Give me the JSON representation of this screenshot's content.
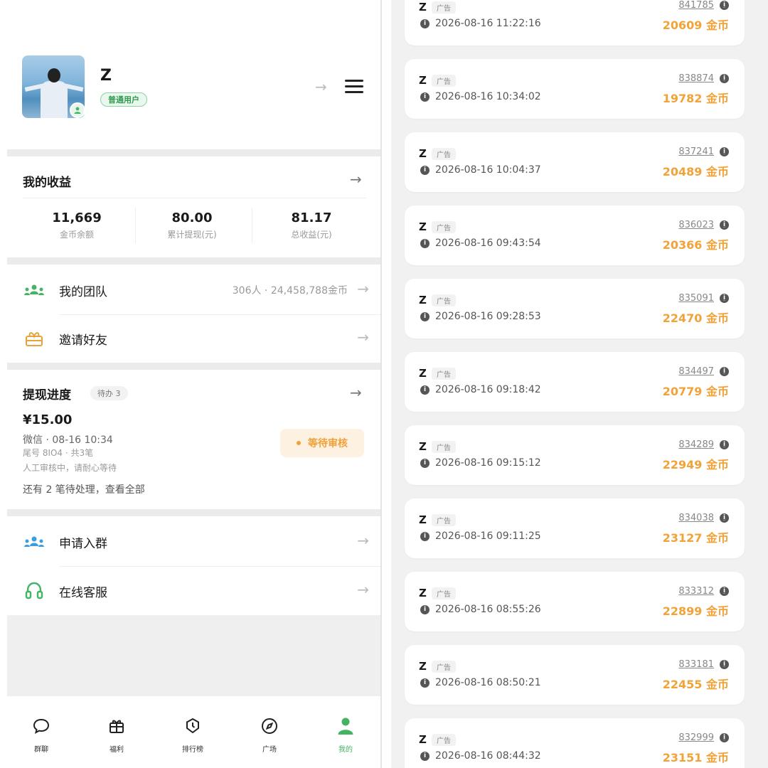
{
  "profile": {
    "name": "Z",
    "badge": "普通用户",
    "arrow": "→"
  },
  "earnings": {
    "title": "我的收益",
    "stats": [
      {
        "value": "11,669",
        "label": "金币余额"
      },
      {
        "value": "80.00",
        "label": "累计提现(元)"
      },
      {
        "value": "81.17",
        "label": "总收益(元)"
      }
    ]
  },
  "team": {
    "label": "我的团队",
    "meta": "306人 · 24,458,788金币"
  },
  "invite": {
    "label": "邀请好友"
  },
  "withdraw": {
    "title": "提现进度",
    "badge": "待办 3",
    "amount": "¥15.00",
    "line1": "微信 · 08-16 10:34",
    "line2": "尾号 8IO4 · 共3笔",
    "line3": "人工审核中，请耐心等待",
    "line4": "还有 2 笔待处理，查看全部",
    "status": "等待审核"
  },
  "join_group": {
    "label": "申请入群"
  },
  "support": {
    "label": "在线客服"
  },
  "tabs": [
    {
      "label": "群聊",
      "icon": "chat-bubble-icon"
    },
    {
      "label": "福利",
      "icon": "gift-icon"
    },
    {
      "label": "排行榜",
      "icon": "ranking-badge-icon"
    },
    {
      "label": "广场",
      "icon": "compass-icon"
    },
    {
      "label": "我的",
      "icon": "user-icon",
      "active": true
    }
  ],
  "records": [
    {
      "name": "Z",
      "tag": "广告",
      "time": "2026-08-16 11:22:16",
      "id": "841785",
      "coins": "20609 金币"
    },
    {
      "name": "Z",
      "tag": "广告",
      "time": "2026-08-16 10:34:02",
      "id": "838874",
      "coins": "19782 金币"
    },
    {
      "name": "Z",
      "tag": "广告",
      "time": "2026-08-16 10:04:37",
      "id": "837241",
      "coins": "20489 金币"
    },
    {
      "name": "Z",
      "tag": "广告",
      "time": "2026-08-16 09:43:54",
      "id": "836023",
      "coins": "20366 金币"
    },
    {
      "name": "Z",
      "tag": "广告",
      "time": "2026-08-16 09:28:53",
      "id": "835091",
      "coins": "22470 金币"
    },
    {
      "name": "Z",
      "tag": "广告",
      "time": "2026-08-16 09:18:42",
      "id": "834497",
      "coins": "20779 金币"
    },
    {
      "name": "Z",
      "tag": "广告",
      "time": "2026-08-16 09:15:12",
      "id": "834289",
      "coins": "22949 金币"
    },
    {
      "name": "Z",
      "tag": "广告",
      "time": "2026-08-16 09:11:25",
      "id": "834038",
      "coins": "23127 金币"
    },
    {
      "name": "Z",
      "tag": "广告",
      "time": "2026-08-16 08:55:26",
      "id": "833312",
      "coins": "22899 金币"
    },
    {
      "name": "Z",
      "tag": "广告",
      "time": "2026-08-16 08:50:21",
      "id": "833181",
      "coins": "22455 金币"
    },
    {
      "name": "Z",
      "tag": "广告",
      "time": "2026-08-16 08:44:32",
      "id": "832999",
      "coins": "23151 金币"
    }
  ],
  "colors": {
    "accent_green": "#46b265",
    "coin_orange": "#f2a237",
    "pending_orange": "#f0a23a"
  }
}
